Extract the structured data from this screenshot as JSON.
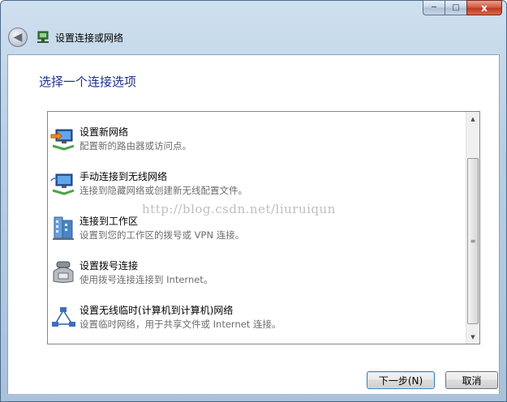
{
  "window": {
    "title": "设置连接或网络",
    "caption_buttons": {
      "minimize": "─",
      "maximize": "□",
      "close": "x"
    }
  },
  "nav": {
    "back_icon": "back-arrow-icon",
    "back_glyph": "◀"
  },
  "heading": "选择一个连接选项",
  "options": [
    {
      "title": "设置新网络",
      "description": "配置新的路由器或访问点。",
      "icon": "new-network-icon"
    },
    {
      "title": "手动连接到无线网络",
      "description": "连接到隐藏网络或创建新无线配置文件。",
      "icon": "wireless-connect-icon"
    },
    {
      "title": "连接到工作区",
      "description": "设置到您的工作区的拨号或 VPN 连接。",
      "icon": "workplace-icon"
    },
    {
      "title": "设置拨号连接",
      "description": "使用拨号连接连接到 Internet。",
      "icon": "dialup-phone-icon"
    },
    {
      "title": "设置无线临时(计算机到计算机)网络",
      "description": "设置临时网络，用于共享文件或 Internet 连接。",
      "icon": "adhoc-network-icon"
    }
  ],
  "watermark": "http://blog.csdn.net/liuruiqun",
  "buttons": {
    "next": "下一步(N)",
    "cancel": "取消"
  },
  "scrollbar": {
    "up": "▲",
    "down": "▼",
    "grip": "≡"
  }
}
